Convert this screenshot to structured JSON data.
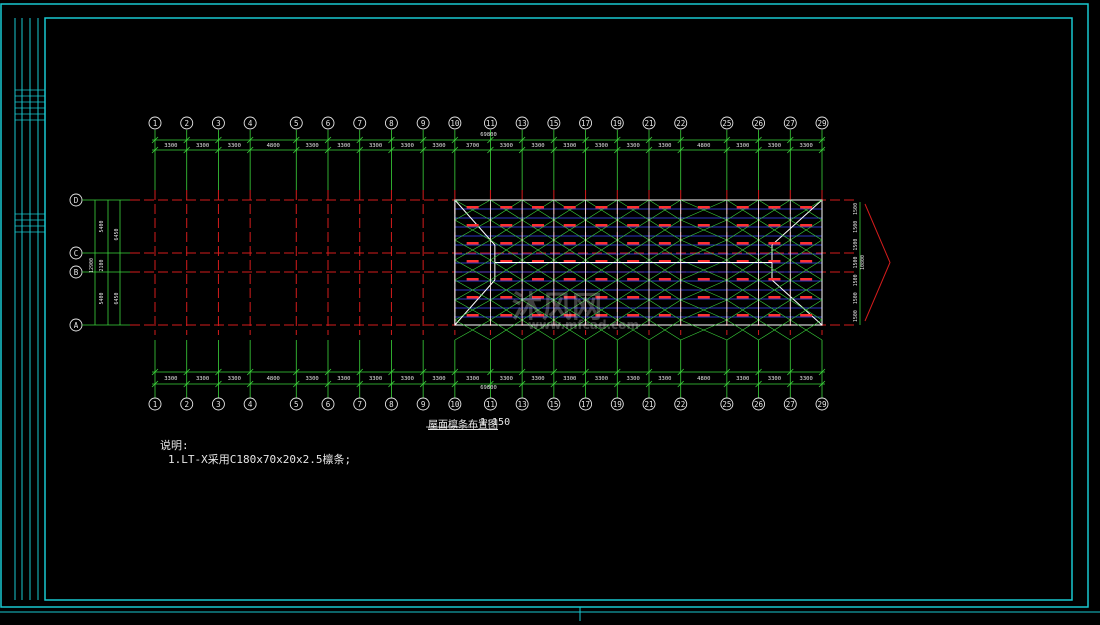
{
  "colors": {
    "frame": "#18c8d0",
    "axis_green": "#3bd43b",
    "grid_red": "#d41c1c",
    "purlin_blue": "#3a48ff",
    "label_red": "#ff3030",
    "text": "#e6e6e6",
    "bubble": "#e6e6e6"
  },
  "drawing": {
    "column_axes": [
      "1",
      "2",
      "3",
      "4",
      "5",
      "6",
      "7",
      "8",
      "9",
      "10",
      "11",
      "13",
      "15",
      "17",
      "19",
      "21",
      "22",
      "25",
      "26",
      "27",
      "29"
    ],
    "spacings_top": [
      "3300",
      "3300",
      "3300",
      "4800",
      "3300",
      "3300",
      "3300",
      "3300",
      "3300",
      "3700",
      "3300",
      "3300",
      "3300",
      "3300",
      "3300",
      "3300",
      "4800",
      "3300",
      "3300",
      "3300"
    ],
    "spacings_bottom": [
      "3300",
      "3300",
      "3300",
      "4800",
      "3300",
      "3300",
      "3300",
      "3300",
      "3300",
      "3300",
      "3300",
      "3300",
      "3300",
      "3300",
      "3300",
      "3300",
      "4800",
      "3300",
      "3300",
      "3300"
    ],
    "total_length": "69800",
    "row_axes": [
      "D",
      "C",
      "B",
      "A"
    ],
    "row_dims_inner": [
      "5400",
      "2100",
      "5400"
    ],
    "row_dims_outer": [
      "6450",
      "6450"
    ],
    "row_total": "12900",
    "right_dims": [
      "1500",
      "1500",
      "1500",
      "1500",
      "1500",
      "1500",
      "1500"
    ],
    "right_total": "10800",
    "title": "屋面檩条布置图",
    "scale": "1:150"
  },
  "notes": {
    "heading": "说明:",
    "line1": "1.LT-X采用C180x70x20x2.5檩条;"
  },
  "watermark": {
    "main": "沐风网",
    "url": "www.mfcad.com"
  }
}
